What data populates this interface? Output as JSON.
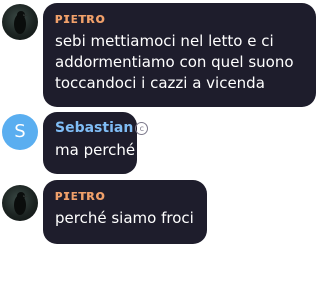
{
  "colors": {
    "bubble_background": "#1e1d2c",
    "sender_pietro": "#f0a06a",
    "sender_sebastian": "#7fbcf4",
    "avatar_sebastian": "#5aaef0",
    "message_text": "#ffffff"
  },
  "messages": [
    {
      "sender": "ᴘɪᴇᴛʀᴏ",
      "avatar": "photo",
      "lines": [
        "sebi mettiamoci nel letto e ci",
        "addormentiamo con quel suono",
        "toccandoci i cazzi a vicenda"
      ]
    },
    {
      "sender": "Sebastian",
      "avatar_letter": "S",
      "badge_icon": "copyright-badge-icon",
      "badge_glyph": "c",
      "lines": [
        "ma perché"
      ]
    },
    {
      "sender": "ᴘɪᴇᴛʀᴏ",
      "avatar": "photo",
      "lines": [
        "perché siamo froci"
      ]
    }
  ]
}
